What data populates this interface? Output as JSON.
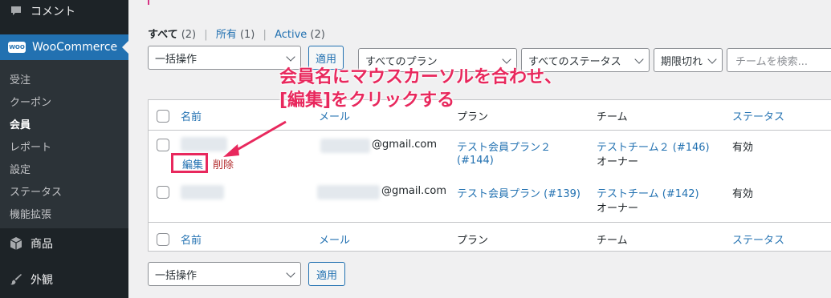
{
  "sidebar": {
    "comments": {
      "label": "コメント",
      "icon": "comment-icon"
    },
    "woocommerce": {
      "label": "WooCommerce",
      "badge": "WOO"
    },
    "submenu": [
      {
        "label": "受注",
        "current": false
      },
      {
        "label": "クーポン",
        "current": false
      },
      {
        "label": "会員",
        "current": true
      },
      {
        "label": "レポート",
        "current": false
      },
      {
        "label": "設定",
        "current": false
      },
      {
        "label": "ステータス",
        "current": false
      },
      {
        "label": "機能拡張",
        "current": false
      }
    ],
    "products": {
      "label": "商品",
      "icon": "archive-icon"
    },
    "appearance": {
      "label": "外観",
      "icon": "paintbrush-icon"
    }
  },
  "views": {
    "all": {
      "label": "すべて",
      "count": "(2)"
    },
    "mine": {
      "label": "所有",
      "count": "(1)"
    },
    "active": {
      "label": "Active",
      "count": "(2)"
    },
    "separator": "|"
  },
  "toolbar": {
    "bulk_action": "一括操作",
    "apply": "適用",
    "plan_filter": "すべてのプラン",
    "status_filter": "すべてのステータス",
    "expire_filter": "期限切れ",
    "team_search_placeholder": "チームを検索..."
  },
  "table": {
    "columns": {
      "name": "名前",
      "email": "メール",
      "plan": "プラン",
      "team": "チーム",
      "status": "ステータス"
    },
    "rows": [
      {
        "email": "@gmail.com",
        "plan": "テスト会員プラン２",
        "plan_id": "(#144)",
        "team": "テストチーム２ (#146)",
        "role": "オーナー",
        "status": "有効",
        "actions": {
          "edit": "編集",
          "delete": "削除"
        }
      },
      {
        "email": "@gmail.com",
        "plan": "テスト会員プラン (#139)",
        "team": "テストチーム (#142)",
        "role": "オーナー",
        "status": "有効"
      }
    ]
  },
  "bottom_toolbar": {
    "bulk_action": "一括操作",
    "apply": "適用"
  },
  "annotation": {
    "line1": "会員名にマウスカーソルを合わせ、",
    "line2": "[編集]をクリックする",
    "color": "#e8285d"
  }
}
